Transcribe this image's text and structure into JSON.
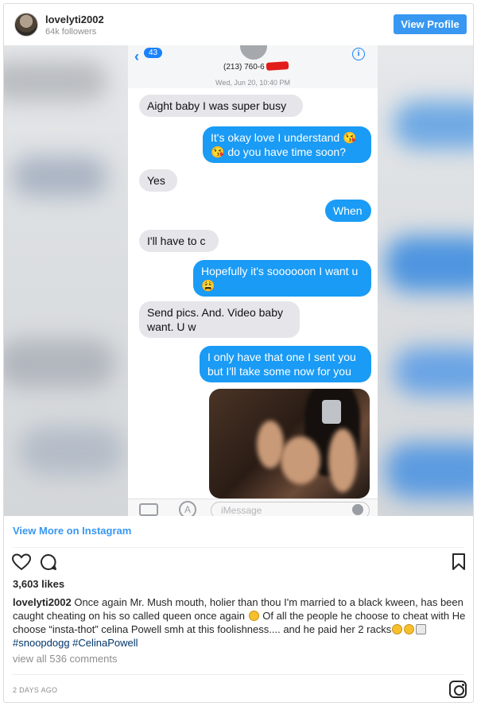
{
  "header": {
    "username": "lovelyti2002",
    "followers": "64k followers",
    "view_profile_label": "View Profile"
  },
  "phone": {
    "back_count": "43",
    "contact_number": "(213) 760-6",
    "timestamp": "Wed, Jun 20, 10:40 PM",
    "messages": [
      {
        "from": "them",
        "text": "Aight baby I was super busy"
      },
      {
        "from": "me",
        "text": "It's okay love I understand 😘 😘 do you have time soon?"
      },
      {
        "from": "them",
        "text": "Yes"
      },
      {
        "from": "me",
        "text": "When"
      },
      {
        "from": "them",
        "text": "I'll have to c"
      },
      {
        "from": "me",
        "text": "Hopefully it's soooooon I want u 😩"
      },
      {
        "from": "them",
        "text": "Send pics. And. Video baby want. U w"
      },
      {
        "from": "me",
        "text": "I only have that one I sent you but I'll take some now for you"
      }
    ],
    "input_placeholder": "iMessage"
  },
  "post": {
    "view_more_label": "View More on Instagram",
    "likes": "3,603 likes",
    "caption_user": "lovelyti2002",
    "caption_text": "Once again Mr. Mush mouth, holier than thou I'm married to a black kween, has been caught cheating on his so called queen once again",
    "caption_text2": "Of all the people he choose to cheat with He choose “insta-thot” celina Powell smh at this foolishness.... and he paid her 2 racks",
    "hashtags": "#snoopdogg #CelinaPowell",
    "view_all_comments": "view all 536 comments",
    "time_ago": "2 DAYS AGO"
  },
  "colors": {
    "accent": "#3897f0",
    "sent_bubble": "#1a9bf5",
    "received_bubble": "#e5e5ea",
    "redaction": "#e21b1b"
  }
}
